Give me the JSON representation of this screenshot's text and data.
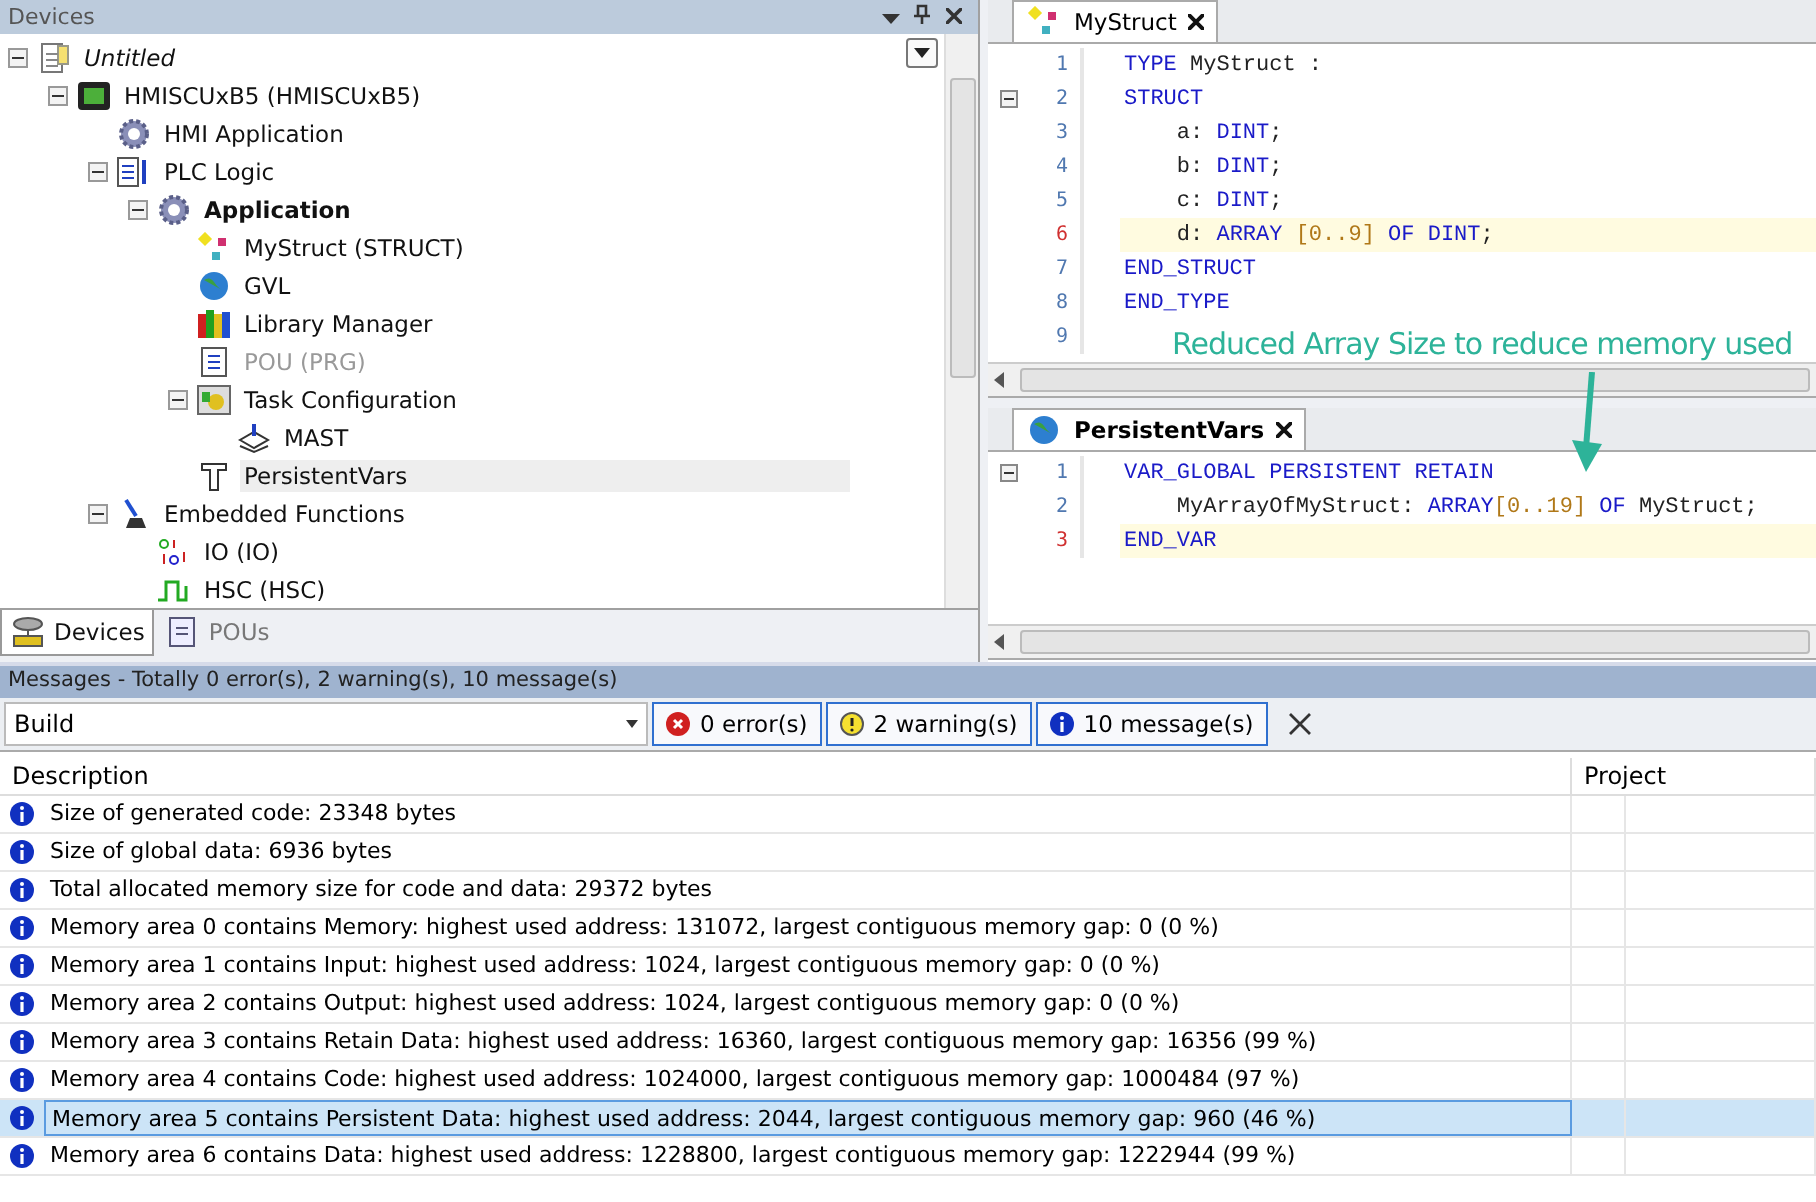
{
  "devices_panel": {
    "title": "Devices",
    "tree": [
      {
        "label": "Untitled",
        "kind": "project",
        "italic": true,
        "expanded": true,
        "children": [
          {
            "label": "HMISCUxB5 (HMISCUxB5)",
            "kind": "device",
            "expanded": true,
            "children": [
              {
                "label": "HMI Application",
                "kind": "gear"
              },
              {
                "label": "PLC Logic",
                "kind": "logic",
                "expanded": true,
                "children": [
                  {
                    "label": "Application",
                    "kind": "gear",
                    "bold": true,
                    "expanded": true,
                    "children": [
                      {
                        "label": "MyStruct (STRUCT)",
                        "kind": "struct"
                      },
                      {
                        "label": "GVL",
                        "kind": "globe"
                      },
                      {
                        "label": "Library Manager",
                        "kind": "books"
                      },
                      {
                        "label": "POU (PRG)",
                        "kind": "page",
                        "disabled": true
                      },
                      {
                        "label": "Task Configuration",
                        "kind": "tasks",
                        "expanded": true,
                        "children": [
                          {
                            "label": "MAST",
                            "kind": "stack"
                          }
                        ]
                      },
                      {
                        "label": "PersistentVars",
                        "kind": "tshape",
                        "selected": true
                      }
                    ]
                  }
                ]
              },
              {
                "label": "Embedded Functions",
                "kind": "joystick",
                "expanded": true,
                "children": [
                  {
                    "label": "IO (IO)",
                    "kind": "bits"
                  },
                  {
                    "label": "HSC (HSC)",
                    "kind": "pulse"
                  }
                ]
              }
            ]
          }
        ]
      }
    ],
    "tabs": [
      {
        "label": "Devices",
        "kind": "devices",
        "selected": true
      },
      {
        "label": "POUs",
        "kind": "pous",
        "selected": false
      }
    ]
  },
  "editors": [
    {
      "tab": "MyStruct",
      "kind": "struct",
      "bold": false,
      "lines": [
        {
          "number": "1",
          "current": false,
          "parts": [
            {
              "kind": "keyword",
              "text": "TYPE "
            },
            {
              "kind": "plain",
              "text": "MyStruct :"
            }
          ]
        },
        {
          "number": "2",
          "current": false,
          "fold": true,
          "parts": [
            {
              "kind": "keyword",
              "text": "STRUCT"
            }
          ]
        },
        {
          "number": "3",
          "current": false,
          "parts": [
            {
              "kind": "plain",
              "text": "    a: "
            },
            {
              "kind": "keyword",
              "text": "DINT"
            },
            {
              "kind": "plain",
              "text": ";"
            }
          ]
        },
        {
          "number": "4",
          "current": false,
          "parts": [
            {
              "kind": "plain",
              "text": "    b: "
            },
            {
              "kind": "keyword",
              "text": "DINT"
            },
            {
              "kind": "plain",
              "text": ";"
            }
          ]
        },
        {
          "number": "5",
          "current": false,
          "parts": [
            {
              "kind": "plain",
              "text": "    c: "
            },
            {
              "kind": "keyword",
              "text": "DINT"
            },
            {
              "kind": "plain",
              "text": ";"
            }
          ]
        },
        {
          "number": "6",
          "current": true,
          "parts": [
            {
              "kind": "plain",
              "text": "    d: "
            },
            {
              "kind": "keyword",
              "text": "ARRAY "
            },
            {
              "kind": "number",
              "text": "[0..9] "
            },
            {
              "kind": "keyword",
              "text": "OF DINT"
            },
            {
              "kind": "plain",
              "text": ";"
            }
          ]
        },
        {
          "number": "7",
          "current": false,
          "parts": [
            {
              "kind": "keyword",
              "text": "END_STRUCT"
            }
          ]
        },
        {
          "number": "8",
          "current": false,
          "parts": [
            {
              "kind": "keyword",
              "text": "END_TYPE"
            }
          ]
        },
        {
          "number": "9",
          "current": false
        }
      ]
    },
    {
      "tab": "PersistentVars",
      "kind": "globe",
      "bold": true,
      "lines": [
        {
          "number": "1",
          "current": false,
          "fold": true,
          "parts": [
            {
              "kind": "keyword",
              "text": "VAR_GLOBAL PERSISTENT RETAIN"
            }
          ]
        },
        {
          "number": "2",
          "current": false,
          "parts": [
            {
              "kind": "plain",
              "text": "    MyArrayOfMyStruct: "
            },
            {
              "kind": "keyword",
              "text": "ARRAY"
            },
            {
              "kind": "number",
              "text": "[0..19] "
            },
            {
              "kind": "keyword",
              "text": "OF "
            },
            {
              "kind": "plain",
              "text": "MyStruct;"
            }
          ]
        },
        {
          "number": "3",
          "current": true,
          "parts": [
            {
              "kind": "keyword",
              "text": "END_VAR"
            }
          ]
        }
      ]
    }
  ],
  "annotation": "Reduced Array Size to reduce memory used",
  "messages": {
    "title": "Messages - Totally 0 error(s), 2 warning(s), 10 message(s)",
    "category": "Build",
    "filters": [
      {
        "label": "0 error(s)",
        "kind": "error"
      },
      {
        "label": "2 warning(s)",
        "kind": "warning"
      },
      {
        "label": "10 message(s)",
        "kind": "info"
      }
    ],
    "columns": [
      "Description",
      "Project"
    ],
    "rows": [
      {
        "text": "Size of generated code: 23348 bytes",
        "selected": false
      },
      {
        "text": "Size of global data: 6936 bytes",
        "selected": false
      },
      {
        "text": "Total allocated memory size for code and data: 29372 bytes",
        "selected": false
      },
      {
        "text": "Memory area 0 contains  Memory: highest used address: 131072, largest contiguous memory gap: 0 (0 %)",
        "selected": false
      },
      {
        "text": "Memory area 1 contains  Input: highest used address: 1024, largest contiguous memory gap: 0 (0 %)",
        "selected": false
      },
      {
        "text": "Memory area 2 contains  Output: highest used address: 1024, largest contiguous memory gap: 0 (0 %)",
        "selected": false
      },
      {
        "text": "Memory area 3 contains  Retain Data: highest used address: 16360, largest contiguous memory gap: 16356 (99 %)",
        "selected": false
      },
      {
        "text": "Memory area 4 contains  Code: highest used address: 1024000, largest contiguous memory gap: 1000484 (97 %)",
        "selected": false
      },
      {
        "text": "Memory area 5 contains  Persistent Data: highest used address: 2044, largest contiguous memory gap: 960 (46 %)",
        "selected": true
      },
      {
        "text": "Memory area 6 contains  Data: highest used address: 1228800, largest contiguous memory gap: 1222944 (99 %)",
        "selected": false
      }
    ]
  }
}
